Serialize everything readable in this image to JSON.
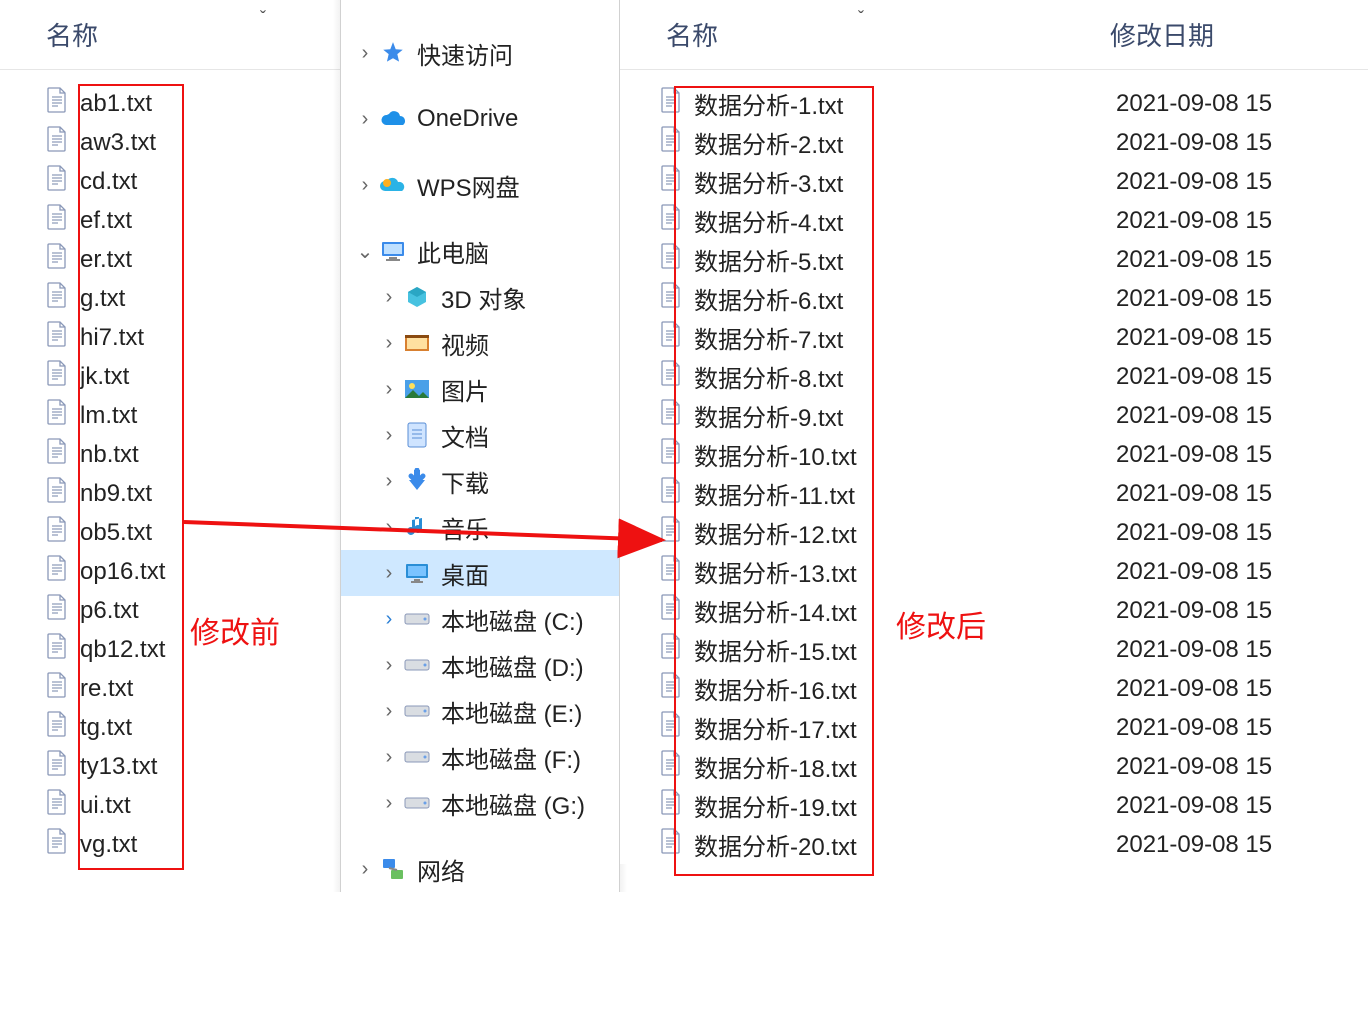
{
  "headers": {
    "name": "名称",
    "date": "修改日期"
  },
  "sort_indicator": "ˇ",
  "annotations": {
    "before_label": "修改前",
    "after_label": "修改后"
  },
  "left_files": [
    "ab1.txt",
    "aw3.txt",
    "cd.txt",
    "ef.txt",
    "er.txt",
    "g.txt",
    "hi7.txt",
    "jk.txt",
    "lm.txt",
    "nb.txt",
    "nb9.txt",
    "ob5.txt",
    "op16.txt",
    "p6.txt",
    "qb12.txt",
    "re.txt",
    "tg.txt",
    "ty13.txt",
    "ui.txt",
    "vg.txt"
  ],
  "right_files": [
    {
      "name": "数据分析-1.txt",
      "date": "2021-09-08 15"
    },
    {
      "name": "数据分析-2.txt",
      "date": "2021-09-08 15"
    },
    {
      "name": "数据分析-3.txt",
      "date": "2021-09-08 15"
    },
    {
      "name": "数据分析-4.txt",
      "date": "2021-09-08 15"
    },
    {
      "name": "数据分析-5.txt",
      "date": "2021-09-08 15"
    },
    {
      "name": "数据分析-6.txt",
      "date": "2021-09-08 15"
    },
    {
      "name": "数据分析-7.txt",
      "date": "2021-09-08 15"
    },
    {
      "name": "数据分析-8.txt",
      "date": "2021-09-08 15"
    },
    {
      "name": "数据分析-9.txt",
      "date": "2021-09-08 15"
    },
    {
      "name": "数据分析-10.txt",
      "date": "2021-09-08 15"
    },
    {
      "name": "数据分析-11.txt",
      "date": "2021-09-08 15"
    },
    {
      "name": "数据分析-12.txt",
      "date": "2021-09-08 15"
    },
    {
      "name": "数据分析-13.txt",
      "date": "2021-09-08 15"
    },
    {
      "name": "数据分析-14.txt",
      "date": "2021-09-08 15"
    },
    {
      "name": "数据分析-15.txt",
      "date": "2021-09-08 15"
    },
    {
      "name": "数据分析-16.txt",
      "date": "2021-09-08 15"
    },
    {
      "name": "数据分析-17.txt",
      "date": "2021-09-08 15"
    },
    {
      "name": "数据分析-18.txt",
      "date": "2021-09-08 15"
    },
    {
      "name": "数据分析-19.txt",
      "date": "2021-09-08 15"
    },
    {
      "name": "数据分析-20.txt",
      "date": "2021-09-08 15"
    }
  ],
  "nav": [
    {
      "label": "快速访问",
      "icon": "quickaccess",
      "chev": "›",
      "indent": 0
    },
    {
      "label": "OneDrive",
      "icon": "onedrive",
      "chev": "›",
      "indent": 0
    },
    {
      "label": "WPS网盘",
      "icon": "wps",
      "chev": "›",
      "indent": 0
    },
    {
      "label": "此电脑",
      "icon": "thispc",
      "chev": "⌄",
      "indent": 0
    },
    {
      "label": "3D 对象",
      "icon": "3d",
      "chev": "›",
      "indent": 1
    },
    {
      "label": "视频",
      "icon": "video",
      "chev": "›",
      "indent": 1
    },
    {
      "label": "图片",
      "icon": "pictures",
      "chev": "›",
      "indent": 1
    },
    {
      "label": "文档",
      "icon": "documents",
      "chev": "›",
      "indent": 1
    },
    {
      "label": "下载",
      "icon": "downloads",
      "chev": "›",
      "indent": 1
    },
    {
      "label": "音乐",
      "icon": "music",
      "chev": "›",
      "indent": 1
    },
    {
      "label": "桌面",
      "icon": "desktop",
      "chev": "›",
      "indent": 1,
      "selected": true
    },
    {
      "label": "本地磁盘 (C:)",
      "icon": "drive",
      "chev": "›",
      "indent": 1,
      "focused": true
    },
    {
      "label": "本地磁盘 (D:)",
      "icon": "drive",
      "chev": "›",
      "indent": 1
    },
    {
      "label": "本地磁盘 (E:)",
      "icon": "drive",
      "chev": "›",
      "indent": 1
    },
    {
      "label": "本地磁盘 (F:)",
      "icon": "drive",
      "chev": "›",
      "indent": 1
    },
    {
      "label": "本地磁盘 (G:)",
      "icon": "drive",
      "chev": "›",
      "indent": 1
    },
    {
      "label": "网络",
      "icon": "network",
      "chev": "›",
      "indent": 0
    }
  ]
}
